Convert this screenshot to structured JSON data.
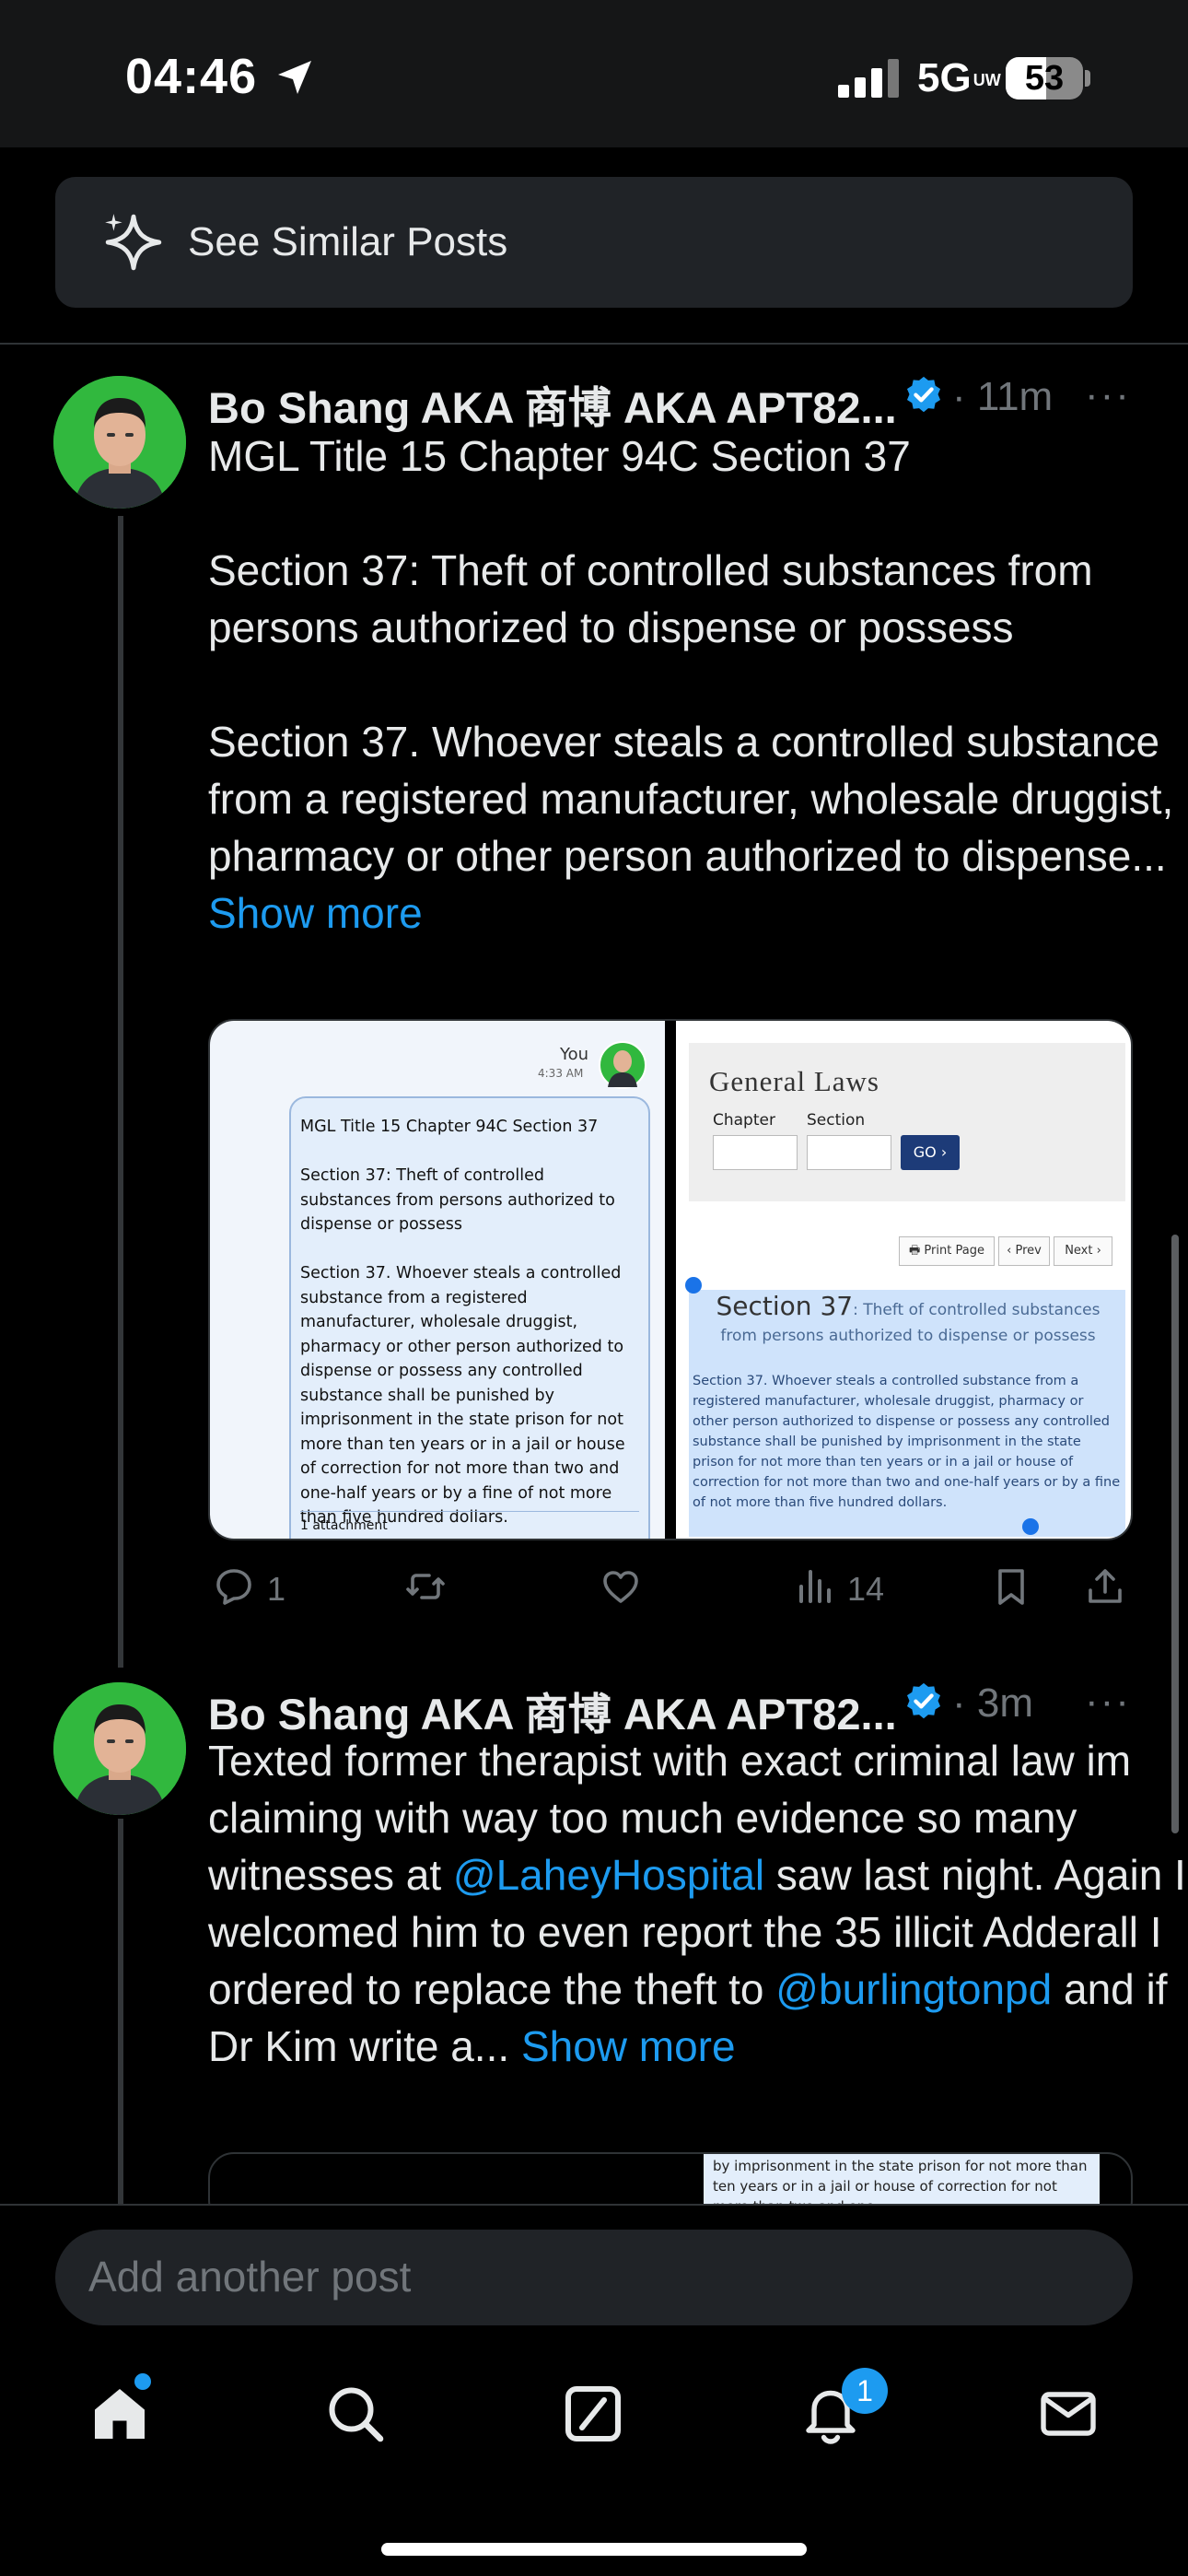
{
  "status_bar": {
    "time": "04:46",
    "network": "5G",
    "network_sub": "UW",
    "battery": "53"
  },
  "similar_posts": {
    "label": "See Similar Posts"
  },
  "posts": [
    {
      "author": "Bo Shang AKA 商博 AKA APT82...",
      "time": "· 11m",
      "more": "···",
      "body": "MGL Title 15 Chapter 94C Section 37\n\nSection 37: Theft of controlled substances from persons authorized to dispense or possess\n\nSection 37. Whoever steals a controlled substance from a registered manufacturer, wholesale druggist, pharmacy or other person authorized to dispense...",
      "show_more": "Show more",
      "media": {
        "left": {
          "sender": "You",
          "timestamp": "4:33 AM",
          "message": "MGL Title 15 Chapter 94C Section 37\n\nSection 37: Theft of controlled substances from persons authorized to dispense or possess\n\nSection 37. Whoever steals a controlled substance from a registered manufacturer, wholesale druggist, pharmacy or other person authorized to dispense or possess any controlled substance shall be punished by imprisonment in the state prison for not more than ten years or in a jail or house of correction for not more than two and one-half years or by a fine of not more than five hundred dollars.",
          "attachment": "1 attachment"
        },
        "right": {
          "title": "General Laws",
          "chapter_label": "Chapter",
          "section_label": "Section",
          "go_label": "GO ›",
          "print_label": "🖶 Print Page",
          "prev_label": "‹ Prev",
          "next_label": "Next ›",
          "heading_num": "Section 37",
          "heading_rest": ": Theft of controlled substances from persons authorized to dispense or possess",
          "section_text": "Section 37. Whoever steals a controlled substance from a registered manufacturer, wholesale druggist, pharmacy or other person authorized to dispense or possess any controlled substance shall be punished by imprisonment in the state prison for not more than ten years or in a jail or house of correction for not more than two and one-half years or by a fine of not more than five hundred dollars."
        }
      },
      "actions": {
        "replies": "1",
        "views": "14"
      }
    },
    {
      "author": "Bo Shang AKA 商博 AKA APT82...",
      "time": "· 3m",
      "more": "···",
      "body_1": "Texted former therapist with exact criminal law im claiming with way too much evidence so many witnesses at ",
      "mention_1": "@LaheyHospital",
      "body_2": " saw last night. Again I welcomed him to even report the 35 illicit Adderall I ordered to replace the theft to ",
      "mention_2": "@burlingtonpd",
      "body_3": " and if Dr Kim write a... ",
      "show_more": "Show more",
      "media_preview": "by imprisonment in the state prison for not more than ten years or in a jail or house of correction for not more than two and one-"
    }
  ],
  "composer": {
    "placeholder": "Add another post"
  },
  "tab_bar": {
    "notifications_badge": "1"
  }
}
